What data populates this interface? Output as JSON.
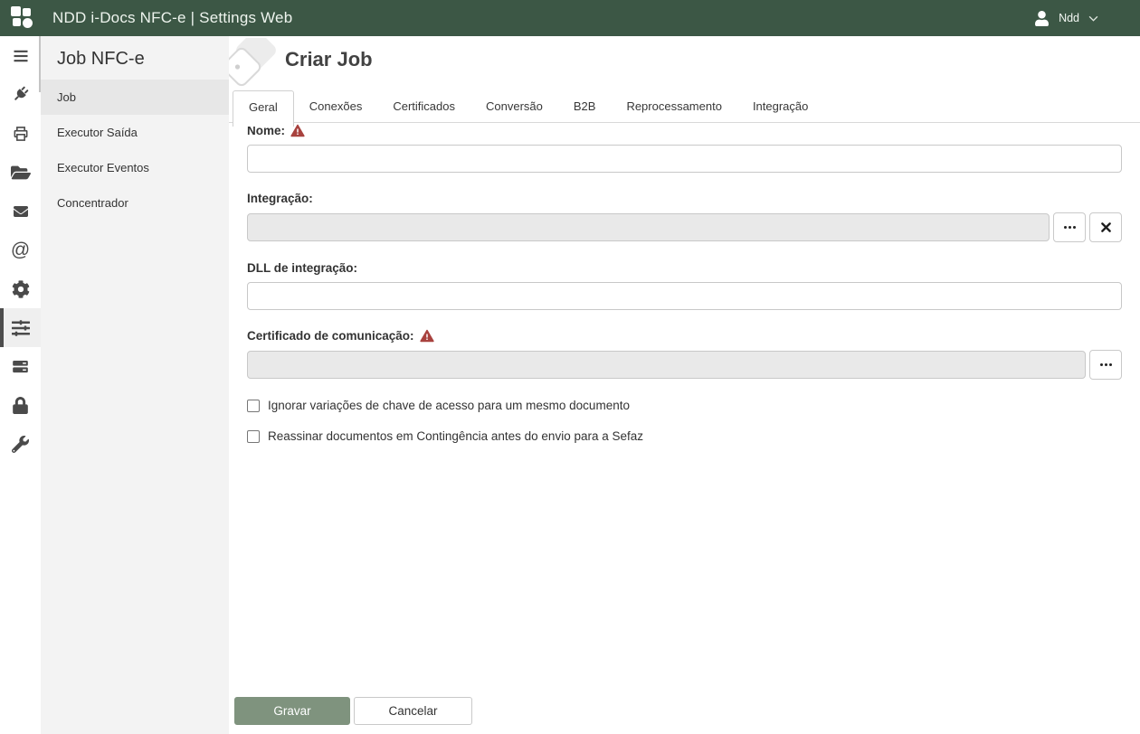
{
  "app": {
    "title": "NDD i-Docs NFC-e | Settings Web",
    "user_name": "Ndd"
  },
  "colors": {
    "topbar_green": "#3c5745",
    "save_button_green": "#7f937e",
    "warning_red": "#a8423e",
    "sidebar_bg": "#f3f3f3",
    "selected_item_bg": "#e7e7e7"
  },
  "icon_rail": {
    "icons": [
      "menu-icon",
      "plug-icon",
      "printer-icon",
      "folder-icon",
      "mail-icon",
      "at-icon",
      "gear-icon",
      "sliders-icon",
      "server-icon",
      "lock-icon",
      "wrench-icon"
    ],
    "selected": "sliders-icon"
  },
  "sidebar": {
    "title": "Job NFC-e",
    "items": [
      {
        "label": "Job",
        "selected": true
      },
      {
        "label": "Executor Saída",
        "selected": false
      },
      {
        "label": "Executor Eventos",
        "selected": false
      },
      {
        "label": "Concentrador",
        "selected": false
      }
    ]
  },
  "main": {
    "page_title": "Criar Job",
    "tabs": [
      {
        "label": "Geral",
        "active": true
      },
      {
        "label": "Conexões",
        "active": false
      },
      {
        "label": "Certificados",
        "active": false
      },
      {
        "label": "Conversão",
        "active": false
      },
      {
        "label": "B2B",
        "active": false
      },
      {
        "label": "Reprocessamento",
        "active": false
      },
      {
        "label": "Integração",
        "active": false
      }
    ],
    "form": {
      "nome": {
        "label": "Nome:",
        "value": "",
        "required": true
      },
      "integracao": {
        "label": "Integração:",
        "value": "",
        "disabled": true,
        "buttons": [
          "ellipsis-icon",
          "x-icon"
        ]
      },
      "dll": {
        "label": "DLL de integração:",
        "value": ""
      },
      "certificado": {
        "label": "Certificado de comunicação:",
        "value": "",
        "required": true,
        "disabled": true,
        "buttons": [
          "ellipsis-icon"
        ]
      },
      "checkboxes": [
        {
          "label": "Ignorar variações de chave de acesso para um mesmo documento",
          "checked": false
        },
        {
          "label": "Reassinar documentos em Contingência antes do envio para a Sefaz",
          "checked": false
        }
      ]
    },
    "actions": {
      "save": "Gravar",
      "cancel": "Cancelar"
    }
  }
}
